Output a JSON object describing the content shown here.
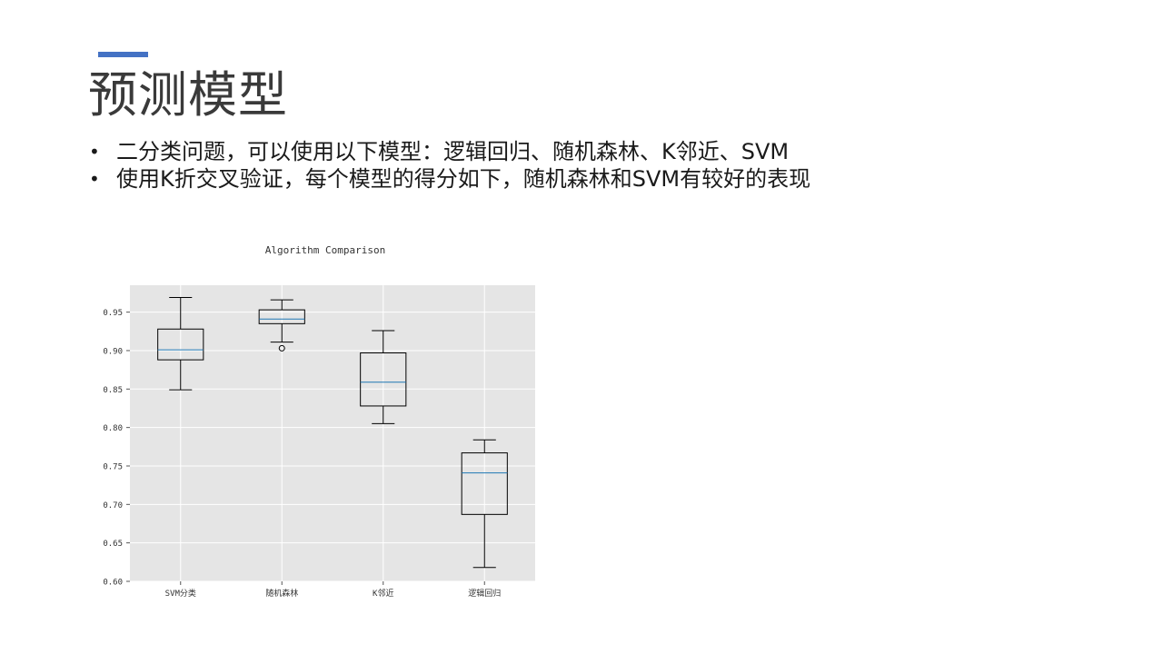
{
  "slide": {
    "title": "预测模型",
    "bullets": [
      "二分类问题，可以使用以下模型：逻辑回归、随机森林、K邻近、SVM",
      "使用K折交叉验证，每个模型的得分如下，随机森林和SVM有较好的表现"
    ],
    "bullet_symbol": "•",
    "accent_color": "#4472c4"
  },
  "chart_data": {
    "type": "box",
    "title": "Algorithm Comparison",
    "xlabel": "",
    "ylabel": "",
    "ylim": [
      0.6,
      0.985
    ],
    "yticks": [
      0.6,
      0.65,
      0.7,
      0.75,
      0.8,
      0.85,
      0.9,
      0.95
    ],
    "ytick_labels": [
      "0.60",
      "0.65",
      "0.70",
      "0.75",
      "0.80",
      "0.85",
      "0.90",
      "0.95"
    ],
    "grid": true,
    "background": "#e5e5e5",
    "median_color": "#1f77b4",
    "categories": [
      "SVM分类",
      "随机森林",
      "K邻近",
      "逻辑回归"
    ],
    "boxes": [
      {
        "whisker_low": 0.849,
        "q1": 0.888,
        "median": 0.901,
        "q3": 0.928,
        "whisker_high": 0.969,
        "outliers": []
      },
      {
        "whisker_low": 0.911,
        "q1": 0.935,
        "median": 0.941,
        "q3": 0.953,
        "whisker_high": 0.966,
        "outliers": [
          0.903
        ]
      },
      {
        "whisker_low": 0.805,
        "q1": 0.828,
        "median": 0.859,
        "q3": 0.897,
        "whisker_high": 0.926,
        "outliers": []
      },
      {
        "whisker_low": 0.618,
        "q1": 0.687,
        "median": 0.741,
        "q3": 0.767,
        "whisker_high": 0.784,
        "outliers": []
      }
    ]
  }
}
